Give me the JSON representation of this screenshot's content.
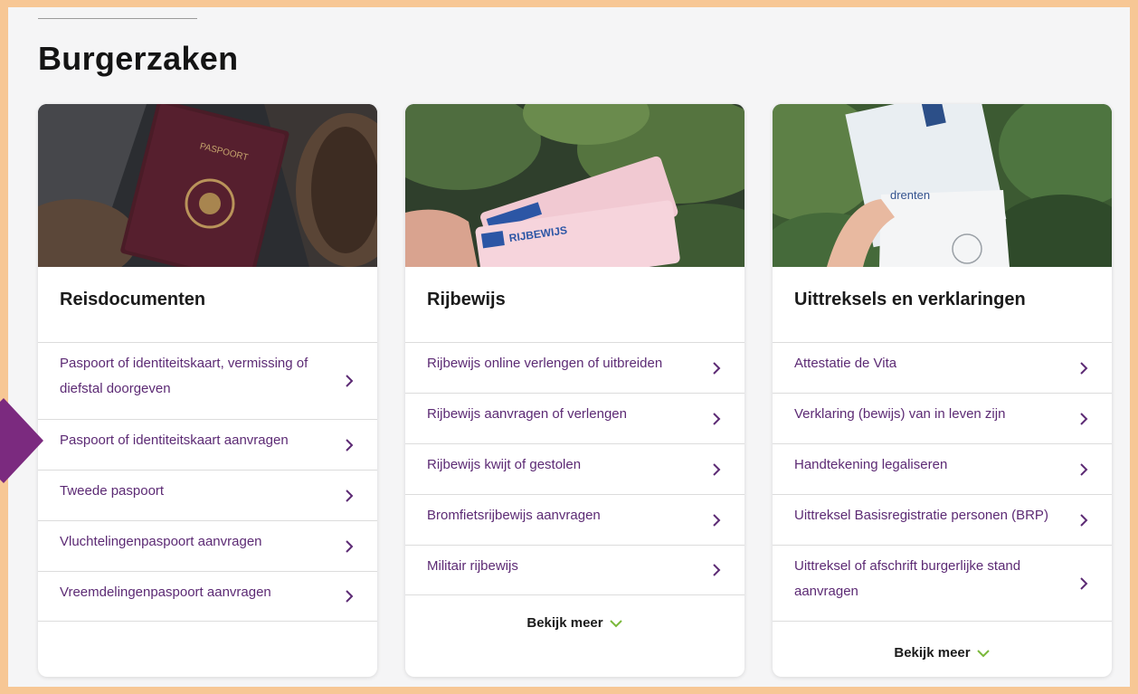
{
  "page": {
    "title": "Burgerzaken"
  },
  "colors": {
    "frame": "#f7c795",
    "link": "#5c2a74",
    "arrow": "#7b2a7f",
    "chevron_more": "#7ab83a"
  },
  "cards": [
    {
      "title": "Reisdocumenten",
      "image": "passport-photo",
      "links": [
        "Paspoort of identiteitskaart, vermissing of diefstal doorgeven",
        "Paspoort of identiteitskaart aanvragen",
        "Tweede paspoort",
        "Vluchtelingenpaspoort aanvragen",
        "Vreemdelingenpaspoort aanvragen"
      ]
    },
    {
      "title": "Rijbewijs",
      "image": "driving-license-photo",
      "image_text": "RIJBEWIJS",
      "links": [
        "Rijbewijs online verlengen of uitbreiden",
        "Rijbewijs aanvragen of verlengen",
        "Rijbewijs kwijt of gestolen",
        "Bromfietsrijbewijs aanvragen",
        "Militair rijbewijs"
      ],
      "more_label": "Bekijk meer"
    },
    {
      "title": "Uittreksels en verklaringen",
      "image": "envelope-photo",
      "image_text": "drenten",
      "links": [
        "Attestatie de Vita",
        "Verklaring (bewijs) van in leven zijn",
        "Handtekening legaliseren",
        "Uittreksel Basisregistratie personen (BRP)",
        "Uittreksel of afschrift burgerlijke stand aanvragen"
      ],
      "more_label": "Bekijk meer"
    }
  ],
  "icons": {
    "link": "chevron-right-icon",
    "more": "chevron-down-icon",
    "pointer": "pointer-arrow-icon"
  }
}
